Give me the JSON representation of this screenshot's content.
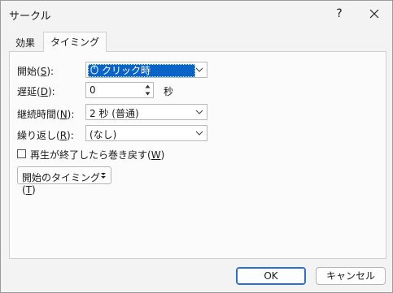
{
  "window": {
    "title": "サークル",
    "help_label": "?"
  },
  "tabs": [
    {
      "label": "効果",
      "active": false
    },
    {
      "label": "タイミング",
      "active": true
    }
  ],
  "fields": {
    "start": {
      "label_pre": "開始(",
      "label_key": "S",
      "label_post": "):",
      "value": "クリック時"
    },
    "delay": {
      "label_pre": "遅延(",
      "label_key": "D",
      "label_post": "):",
      "value": "0",
      "unit": "秒"
    },
    "duration": {
      "label_pre": "継続時間(",
      "label_key": "N",
      "label_post": "):",
      "value": "2 秒 (普通)"
    },
    "repeat": {
      "label_pre": "繰り返し(",
      "label_key": "R",
      "label_post": "):",
      "value": "(なし)"
    }
  },
  "rewind": {
    "label_pre": "再生が終了したら巻き戻す(",
    "label_key": "W",
    "label_post": ")",
    "checked": false
  },
  "trigger_button": {
    "label_pre": "開始のタイミング(",
    "label_key": "T",
    "label_post": ")"
  },
  "buttons": {
    "ok": "OK",
    "cancel": "キャンセル"
  },
  "colors": {
    "accent": "#0a64c8",
    "ok_border": "#2a6fd8"
  }
}
